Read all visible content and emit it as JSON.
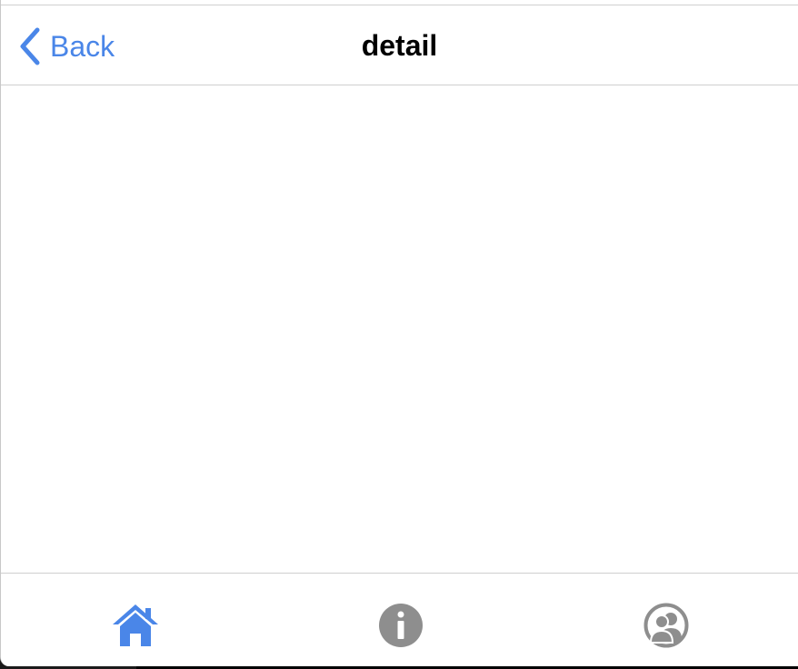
{
  "nav": {
    "back_label": "Back",
    "title": "detail"
  },
  "tabs": [
    {
      "icon": "home-icon",
      "selected": true
    },
    {
      "icon": "info-icon",
      "selected": false
    },
    {
      "icon": "users-icon",
      "selected": false
    }
  ],
  "colors": {
    "accent": "#4a86e8",
    "inactive": "#8e8e8e",
    "background": "#ffffff",
    "separator": "#cfcfcf"
  }
}
